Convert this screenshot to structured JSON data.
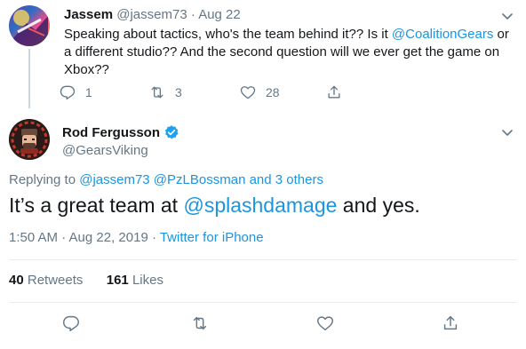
{
  "parent_tweet": {
    "name": "Jassem",
    "handle": "@jassem73",
    "separator": "·",
    "date": "Aug 22",
    "text_before": "Speaking about tactics, who's the team behind it?? Is it ",
    "mention": "@CoalitionGears",
    "text_after": " or a different studio?? And the second question will we ever get the game on Xbox??",
    "reply_count": "1",
    "retweet_count": "3",
    "like_count": "28"
  },
  "main_tweet": {
    "name": "Rod Fergusson",
    "handle": "@GearsViking",
    "verified": true,
    "replying_prefix": "Replying to ",
    "replying_to": "@jassem73 @PzLBossman and 3 others",
    "text_before": "It’s a great team at ",
    "mention": "@splashdamage",
    "text_after": " and yes.",
    "time": "1:50 AM · Aug 22, 2019 · ",
    "client": "Twitter for iPhone",
    "retweets_count": "40",
    "retweets_label": "Retweets",
    "likes_count": "161",
    "likes_label": "Likes"
  },
  "colors": {
    "link": "#1b95e0",
    "muted": "#657786",
    "text": "#14171a",
    "verified": "#1da1f2",
    "divider": "#e6ecf0"
  },
  "icons": {
    "reply": "reply-icon",
    "retweet": "retweet-icon",
    "like": "heart-icon",
    "share": "share-icon",
    "caret": "chevron-down-icon",
    "verified": "verified-badge-icon"
  }
}
